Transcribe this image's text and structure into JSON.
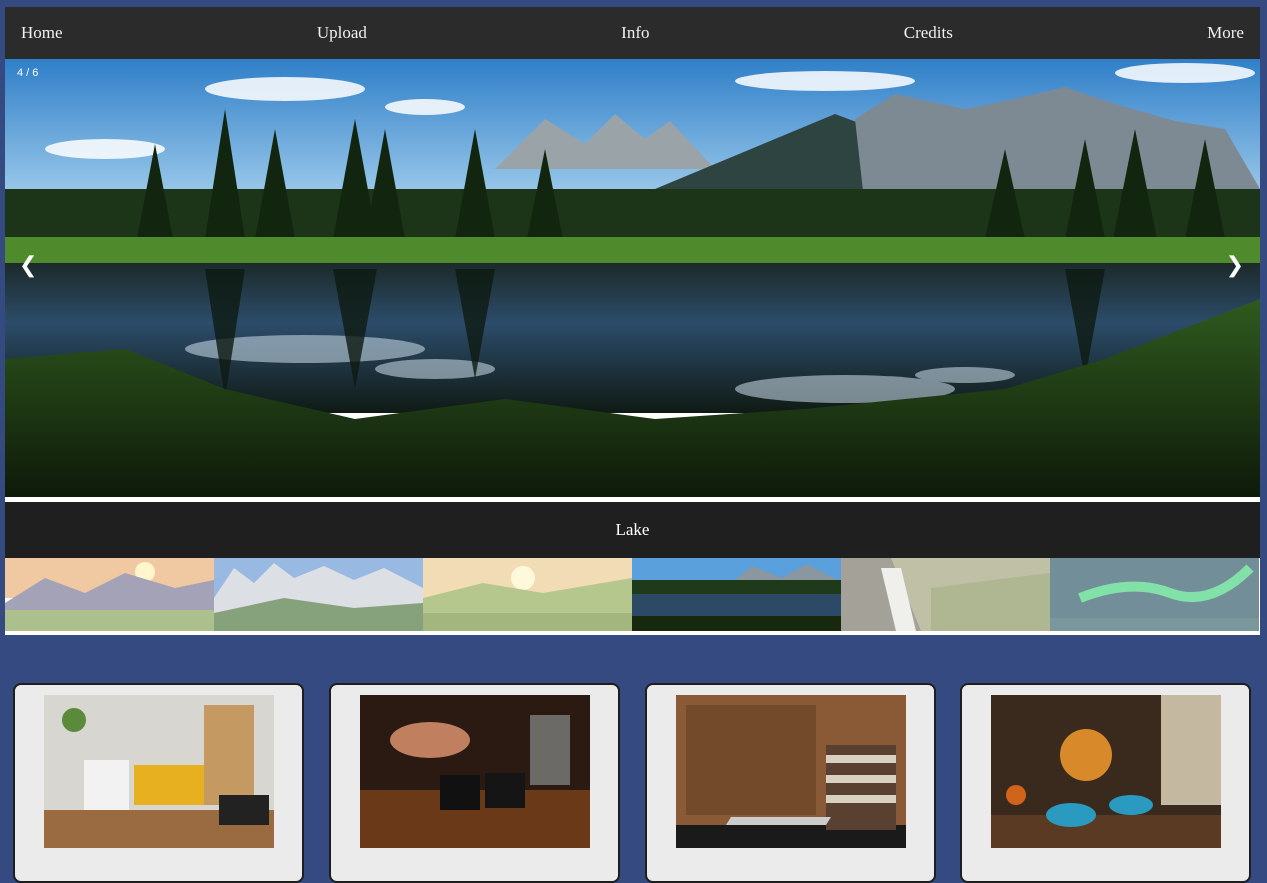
{
  "nav": {
    "items": [
      "Home",
      "Upload",
      "Info",
      "Credits",
      "More"
    ]
  },
  "slideshow": {
    "counter": "4 / 6",
    "prev_glyph": "❮",
    "next_glyph": "❯",
    "caption": "Lake",
    "active_index": 4,
    "total": 6,
    "thumbnails": [
      {
        "subject": "sunset-meadow"
      },
      {
        "subject": "jagged-peaks"
      },
      {
        "subject": "golden-hills"
      },
      {
        "subject": "lake-reflection"
      },
      {
        "subject": "waterfall"
      },
      {
        "subject": "aurora"
      }
    ]
  },
  "cards": [
    {
      "subject": "home-office"
    },
    {
      "subject": "coffee-bar"
    },
    {
      "subject": "laptop-books"
    },
    {
      "subject": "tea-pouring"
    }
  ],
  "colors": {
    "page_bg": "#354a80",
    "nav_bg": "#2b2b2b",
    "caption_bg": "#1f1f1f",
    "card_bg": "#ebebeb"
  }
}
